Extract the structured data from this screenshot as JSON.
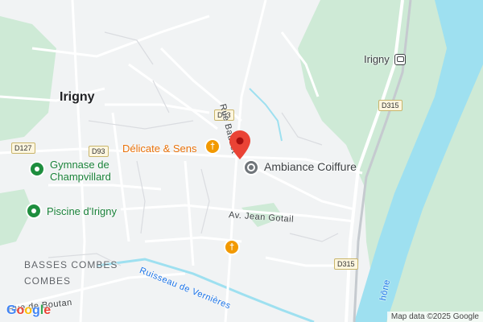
{
  "map": {
    "town_label": "Irigny",
    "station_label": "Irigny",
    "streets": {
      "rue_baudet": "Rue Baudet",
      "av_jean_gotail": "Av. Jean Gotail",
      "rue_de_boutan": "Rue de Boutan",
      "stream": "Ruisseau de Vernières",
      "river_fragment": "hône"
    },
    "route_shields": [
      "D93",
      "D93",
      "D127",
      "D315",
      "D315"
    ],
    "pois": {
      "gymnase_line1": "Gymnase de",
      "gymnase_line2": "Champvillard",
      "piscine": "Piscine d'Irigny",
      "restaurant": "Délicate & Sens",
      "salon": "Ambiance Coiffure"
    },
    "districts": {
      "basses_combes": "BASSES COMBES",
      "combes": "COMBES"
    },
    "icons": [
      "pin-marker-icon",
      "restaurant-icon",
      "park-icon",
      "salon-icon",
      "train-icon"
    ],
    "colors": {
      "background": "#f1f3f4",
      "park": "#ceead6",
      "water": "#9ee0f0",
      "pin": "#ea4335",
      "restaurant": "#f29900",
      "park_poi": "#1e8e3e"
    },
    "attribution": "Map data ©2025 Google",
    "google_logo": "Google"
  }
}
